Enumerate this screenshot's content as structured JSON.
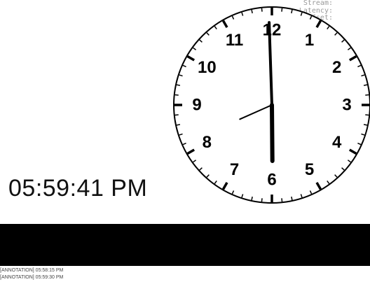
{
  "stats": {
    "stream": "Stream:",
    "latency": "Latency:",
    "delay_offset": "DelayOffset:"
  },
  "clock": {
    "numerals": [
      "12",
      "1",
      "2",
      "3",
      "4",
      "5",
      "6",
      "7",
      "8",
      "9",
      "10",
      "11"
    ],
    "time": {
      "hours": 5,
      "minutes": 59,
      "seconds": 41
    },
    "face_color": "#ffffff",
    "ink_color": "#000000"
  },
  "digital_time": "05:59:41 PM",
  "annotations": [
    "[ANNOTATION] 05:58:15 PM",
    "[ANNOTATION] 05:59:30 PM"
  ]
}
